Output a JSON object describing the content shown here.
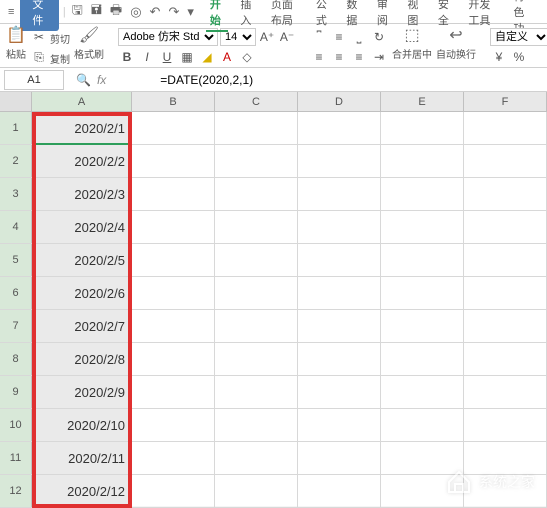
{
  "menubar": {
    "file_label": "文件",
    "tabs": [
      "开始",
      "插入",
      "页面布局",
      "公式",
      "数据",
      "审阅",
      "视图",
      "安全",
      "开发工具",
      "特色功"
    ]
  },
  "ribbon": {
    "cut_label": "剪切",
    "paste_label": "粘贴",
    "copy_label": "复制",
    "format_painter_label": "格式刷",
    "font_name": "Adobe 仿宋 Std R",
    "font_size": "14",
    "merge_label": "合并居中",
    "wrap_label": "自动换行",
    "numfmt_label": "自定义"
  },
  "fxbar": {
    "name_box": "A1",
    "formula": "=DATE(2020,2,1)"
  },
  "columns": [
    "A",
    "B",
    "C",
    "D",
    "E",
    "F"
  ],
  "rows": [
    {
      "n": "1",
      "a": "2020/2/1"
    },
    {
      "n": "2",
      "a": "2020/2/2"
    },
    {
      "n": "3",
      "a": "2020/2/3"
    },
    {
      "n": "4",
      "a": "2020/2/4"
    },
    {
      "n": "5",
      "a": "2020/2/5"
    },
    {
      "n": "6",
      "a": "2020/2/6"
    },
    {
      "n": "7",
      "a": "2020/2/7"
    },
    {
      "n": "8",
      "a": "2020/2/8"
    },
    {
      "n": "9",
      "a": "2020/2/9"
    },
    {
      "n": "10",
      "a": "2020/2/10"
    },
    {
      "n": "11",
      "a": "2020/2/11"
    },
    {
      "n": "12",
      "a": "2020/2/12"
    }
  ],
  "watermark": {
    "text": "系统之家"
  }
}
